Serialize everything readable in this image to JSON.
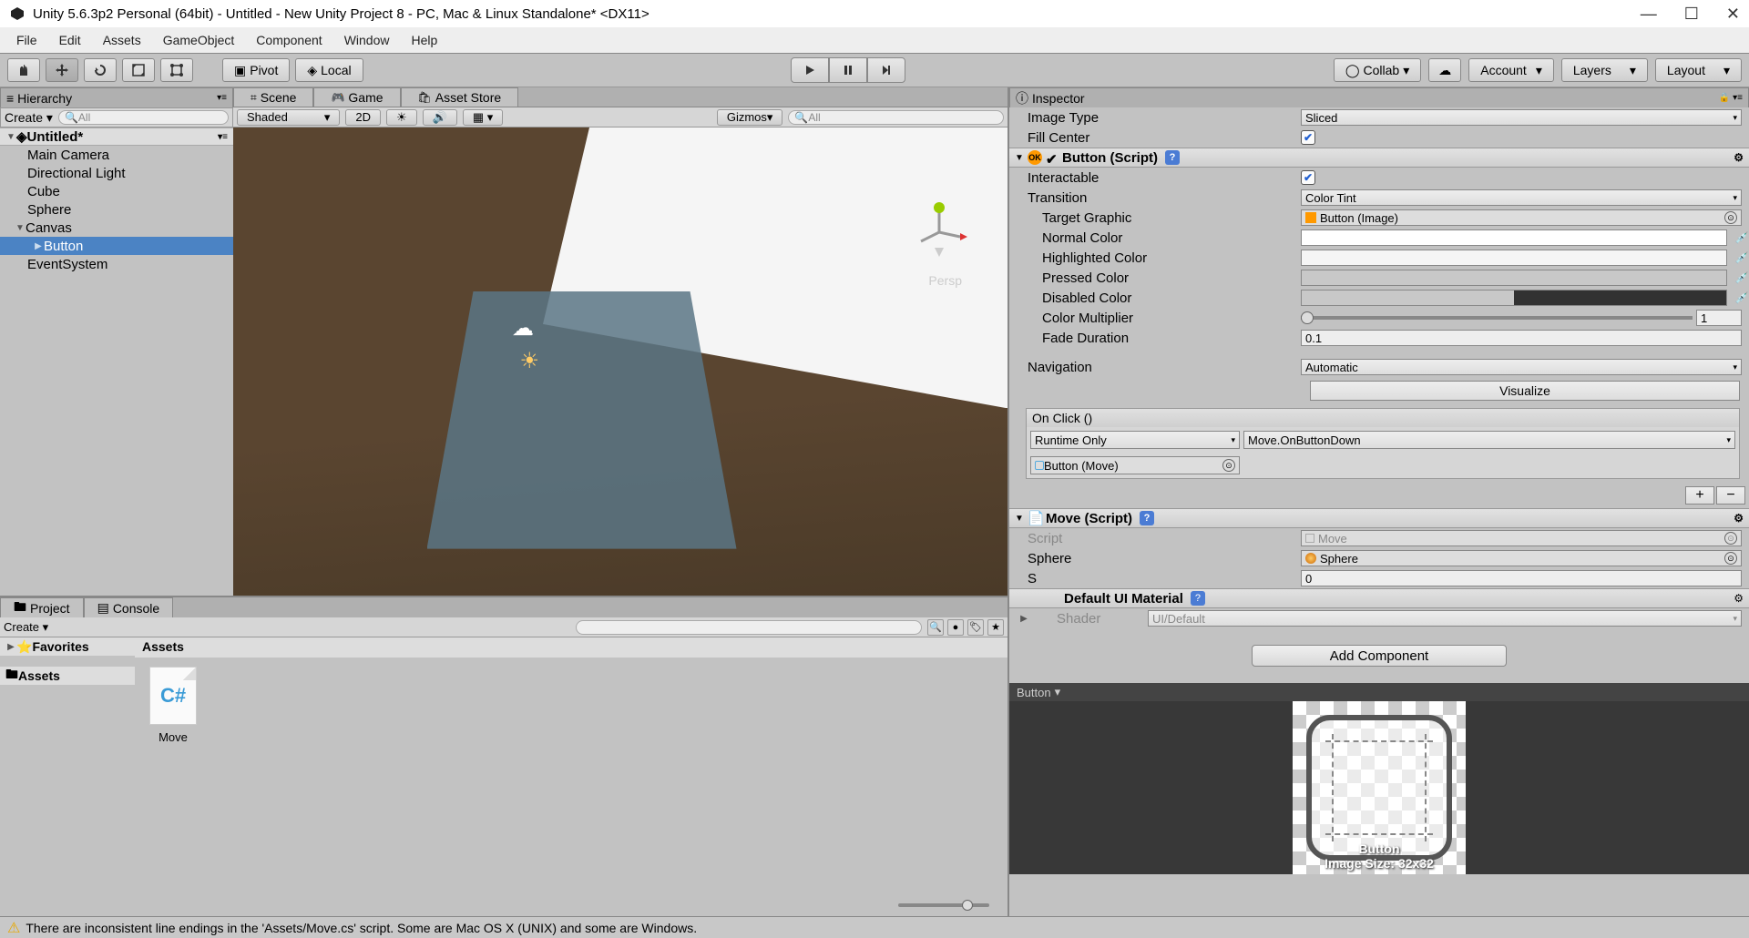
{
  "title": "Unity 5.6.3p2 Personal (64bit) - Untitled - New Unity Project 8 - PC, Mac & Linux Standalone* <DX11>",
  "menu": [
    "File",
    "Edit",
    "Assets",
    "GameObject",
    "Component",
    "Window",
    "Help"
  ],
  "toolbar": {
    "pivot": "Pivot",
    "local": "Local",
    "collab": "Collab",
    "account": "Account",
    "layers": "Layers",
    "layout": "Layout"
  },
  "hierarchy": {
    "title": "Hierarchy",
    "create": "Create",
    "search_placeholder": "All",
    "scene": "Untitled*",
    "items": [
      "Main Camera",
      "Directional Light",
      "Cube",
      "Sphere",
      "Canvas",
      "Button",
      "EventSystem"
    ]
  },
  "scene_tabs": {
    "scene": "Scene",
    "game": "Game",
    "asset_store": "Asset Store"
  },
  "scene_bar": {
    "shaded": "Shaded",
    "mode2d": "2D",
    "gizmos": "Gizmos",
    "search_placeholder": "All",
    "persp": "Persp"
  },
  "project": {
    "project_tab": "Project",
    "console_tab": "Console",
    "create": "Create",
    "favorites": "Favorites",
    "assets": "Assets",
    "crumb": "Assets",
    "item": "Move",
    "cs": "C#"
  },
  "inspector": {
    "title": "Inspector",
    "image_type_label": "Image Type",
    "image_type_value": "Sliced",
    "fill_center_label": "Fill Center",
    "button_header": "Button (Script)",
    "interactable": "Interactable",
    "transition_label": "Transition",
    "transition_value": "Color Tint",
    "target_graphic_label": "Target Graphic",
    "target_graphic_value": "Button (Image)",
    "normal_color": "Normal Color",
    "highlighted_color": "Highlighted Color",
    "pressed_color": "Pressed Color",
    "disabled_color": "Disabled Color",
    "color_multiplier": "Color Multiplier",
    "color_multiplier_value": "1",
    "fade_duration": "Fade Duration",
    "fade_duration_value": "0.1",
    "navigation_label": "Navigation",
    "navigation_value": "Automatic",
    "visualize": "Visualize",
    "onclick_header": "On Click ()",
    "runtime_only": "Runtime Only",
    "callback": "Move.OnButtonDown",
    "target_obj": "Button (Move)",
    "move_header": "Move (Script)",
    "script_label": "Script",
    "script_value": "Move",
    "sphere_label": "Sphere",
    "sphere_value": "Sphere",
    "s_label": "S",
    "s_value": "0",
    "default_material": "Default UI Material",
    "shader_label": "Shader",
    "shader_value": "UI/Default",
    "add_component": "Add Component",
    "preview_title": "Button",
    "preview_name": "Button",
    "preview_size": "Image Size: 32x32"
  },
  "status": "There are inconsistent line endings in the 'Assets/Move.cs' script. Some are Mac OS X (UNIX) and some are Windows."
}
